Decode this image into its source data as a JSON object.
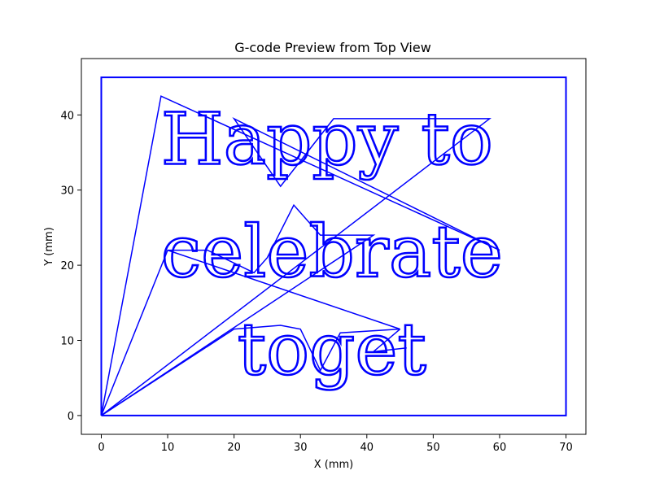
{
  "chart_data": {
    "type": "line",
    "title": "G-code Preview from Top View",
    "xlabel": "X (mm)",
    "ylabel": "Y (mm)",
    "xlim": [
      -3,
      73
    ],
    "ylim": [
      -2.5,
      47.5
    ],
    "xticks": [
      0,
      10,
      20,
      30,
      40,
      50,
      60,
      70
    ],
    "yticks": [
      0,
      10,
      20,
      30,
      40
    ],
    "grid": false,
    "series_color": "#0000ff",
    "series": [
      {
        "border": [
          [
            0,
            0
          ],
          [
            0,
            45
          ],
          [
            70,
            45
          ],
          [
            70,
            0
          ],
          [
            0,
            0
          ]
        ],
        "travel_moves": [
          [
            [
              0,
              0
            ],
            [
              9,
              42.5
            ],
            [
              60,
              22
            ]
          ],
          [
            [
              60,
              22
            ],
            [
              20,
              39.5
            ],
            [
              27,
              30.5
            ],
            [
              35,
              39.5
            ],
            [
              50,
              39.5
            ],
            [
              58.5,
              39.5
            ],
            [
              0,
              0
            ]
          ],
          [
            [
              0,
              0
            ],
            [
              10,
              22
            ],
            [
              16,
              22
            ],
            [
              23,
              19
            ],
            [
              25,
              21
            ],
            [
              29,
              28
            ],
            [
              33,
              24
            ],
            [
              41,
              24
            ],
            [
              0,
              0
            ]
          ],
          [
            [
              0,
              0
            ],
            [
              20,
              11.5
            ],
            [
              27,
              12
            ],
            [
              30,
              11.5
            ],
            [
              33,
              6
            ],
            [
              36,
              11
            ],
            [
              45,
              11.5
            ],
            [
              10,
              22
            ]
          ],
          [
            [
              45,
              11.5
            ],
            [
              41,
              8.5
            ],
            [
              46,
              9
            ]
          ]
        ]
      }
    ],
    "text_lines": [
      {
        "text": "Happy to",
        "x": 9,
        "y": 33.5
      },
      {
        "text": "celebrate",
        "x": 9,
        "y": 18.5
      },
      {
        "text": "toget",
        "x": 20.5,
        "y": 5.5
      }
    ]
  }
}
